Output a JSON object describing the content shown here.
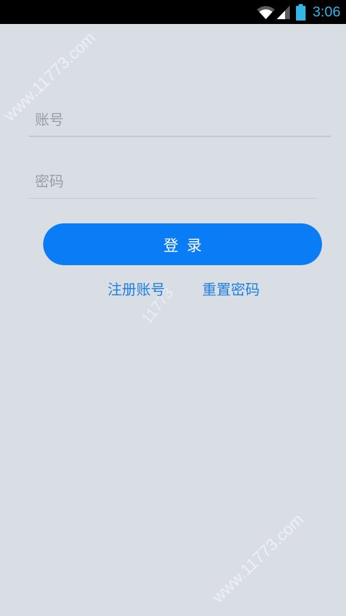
{
  "status_bar": {
    "time": "3:06",
    "icons": [
      "wifi-icon",
      "signal-icon",
      "battery-icon"
    ],
    "clock_color": "#33b5e5"
  },
  "form": {
    "account_placeholder": "账号",
    "account_value": "",
    "password_placeholder": "密码",
    "password_value": ""
  },
  "login_button": {
    "label": "登录",
    "color": "#0a7cf5"
  },
  "links": {
    "register": "注册账号",
    "reset": "重置密码",
    "color": "#1f7fe0"
  },
  "watermark": {
    "text_top": "www.11773.com",
    "text_mid": "11773",
    "text_bottom": "www.11773.com"
  },
  "colors": {
    "background": "#d9dee5"
  }
}
